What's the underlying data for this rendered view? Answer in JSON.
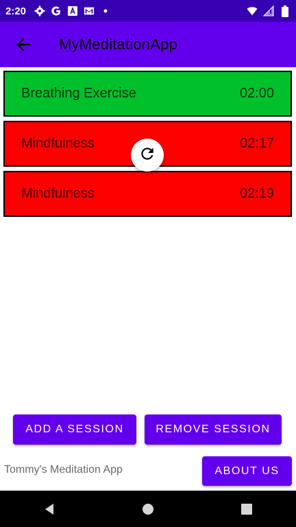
{
  "status_bar": {
    "time": "2:20",
    "icons": [
      "settings-icon",
      "google-icon",
      "translate-icon",
      "gmail-icon",
      "dot-icon",
      "wifi-icon",
      "signal-icon",
      "battery-icon"
    ]
  },
  "app_bar": {
    "title": "MyMeditationApp",
    "back_icon": "arrow-back-icon"
  },
  "sessions": [
    {
      "name": "Breathing Exercise",
      "duration": "02:00",
      "color": "#00c12b"
    },
    {
      "name": "Mindfulness",
      "duration": "02:17",
      "color": "#ff0000"
    },
    {
      "name": "Mindfulness",
      "duration": "02:19",
      "color": "#ff0000"
    }
  ],
  "actions": {
    "add_label": "ADD A SESSION",
    "remove_label": "REMOVE SESSION",
    "about_label": "ABOUT US"
  },
  "footer": {
    "text": "Tommy's Meditation App"
  },
  "colors": {
    "primary": "#6200ee",
    "primary_dark": "#3700b3"
  },
  "nav_bar": {
    "icons": [
      "back-triangle-icon",
      "home-circle-icon",
      "recents-square-icon"
    ]
  }
}
